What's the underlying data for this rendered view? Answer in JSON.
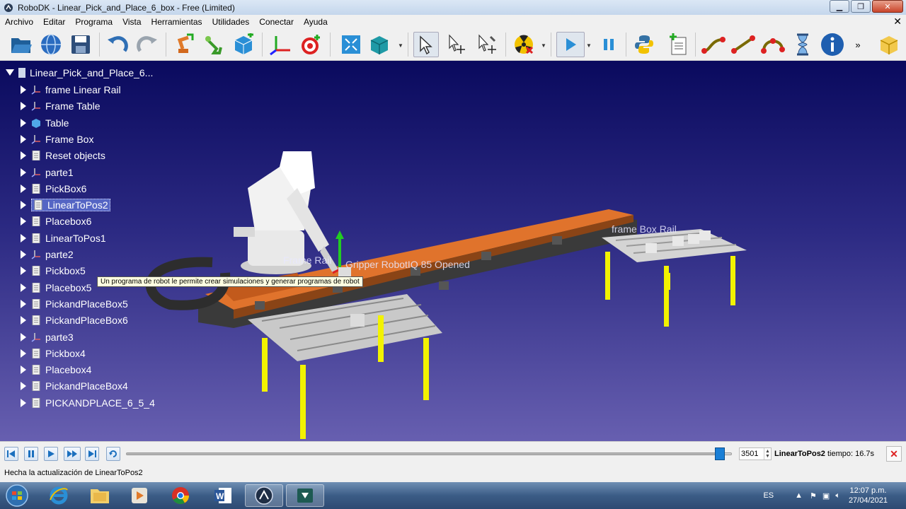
{
  "window": {
    "title": "RoboDK - Linear_Pick_and_Place_6_box - Free (Limited)"
  },
  "menu": [
    "Archivo",
    "Editar",
    "Programa",
    "Vista",
    "Herramientas",
    "Utilidades",
    "Conectar",
    "Ayuda"
  ],
  "toolbar": {
    "icons": [
      "open-icon",
      "globe-icon",
      "save-icon",
      "undo-icon",
      "redo-icon",
      "add-robot-icon",
      "add-tool-icon",
      "add-object-icon",
      "add-frame-icon",
      "add-target-icon",
      "fit-all-icon",
      "view-cube-icon",
      "select-icon",
      "move-reference-icon",
      "move-tcp-icon",
      "collision-icon",
      "run-icon",
      "pause-icon",
      "python-icon",
      "new-program-icon",
      "move-joint-icon",
      "move-linear-icon",
      "move-circular-icon",
      "pause-instruction-icon",
      "info-icon",
      "more-icon",
      "model-icon"
    ]
  },
  "tree": {
    "root": "Linear_Pick_and_Place_6...",
    "items": [
      {
        "label": "frame Linear Rail",
        "icon": "frame-icon"
      },
      {
        "label": "Frame Table",
        "icon": "frame-icon"
      },
      {
        "label": "Table",
        "icon": "object-icon"
      },
      {
        "label": "Frame Box",
        "icon": "frame-icon"
      },
      {
        "label": "Reset objects",
        "icon": "program-icon"
      },
      {
        "label": "parte1",
        "icon": "frame-icon"
      },
      {
        "label": "PickBox6",
        "icon": "program-icon"
      },
      {
        "label": "LinearToPos2",
        "icon": "program-icon",
        "selected": true
      },
      {
        "label": "Placebox6",
        "icon": "program-icon"
      },
      {
        "label": "LinearToPos1",
        "icon": "program-icon"
      },
      {
        "label": "parte2",
        "icon": "frame-icon"
      },
      {
        "label": "Pickbox5",
        "icon": "program-icon"
      },
      {
        "label": "Placebox5",
        "icon": "program-icon"
      },
      {
        "label": "PickandPlaceBox5",
        "icon": "program-icon"
      },
      {
        "label": "PickandPlaceBox6",
        "icon": "program-icon"
      },
      {
        "label": "parte3",
        "icon": "frame-icon"
      },
      {
        "label": "Pickbox4",
        "icon": "program-icon"
      },
      {
        "label": "Placebox4",
        "icon": "program-icon"
      },
      {
        "label": "PickandPlaceBox4",
        "icon": "program-icon"
      },
      {
        "label": "PICKANDPLACE_6_5_4",
        "icon": "program-icon"
      }
    ]
  },
  "tooltip": "Un programa de robot le permite crear simulaciones y generar programas de robot",
  "viewport_labels": {
    "gripper": "Gripper RobotIQ 85 Opened",
    "frame_rail": "Frame Rail",
    "frame_box_rail": "frame Box Rail"
  },
  "playback": {
    "progress": 0.98,
    "value": "3501",
    "program": "LinearToPos2",
    "time_label": "tiempo: 16.7s"
  },
  "status": "Hecha la actualización de LinearToPos2",
  "taskbar": {
    "apps": [
      "start-icon",
      "ie-icon",
      "explorer-icon",
      "media-icon",
      "chrome-icon",
      "word-icon",
      "robodk-icon",
      "app-icon"
    ],
    "lang": "ES",
    "time": "12:07 p.m.",
    "date": "27/04/2021"
  },
  "colors": {
    "accent": "#1a7fd6",
    "viewport_top": "#0a0a5e",
    "viewport_bottom": "#675fb0",
    "rail": "#e0732c"
  }
}
